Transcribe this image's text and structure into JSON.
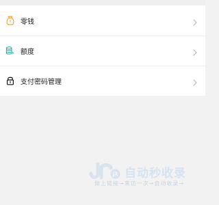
{
  "menu": {
    "items": [
      {
        "label": "零钱",
        "icon": "money-bag-icon"
      },
      {
        "label": "额度",
        "icon": "coin-stack-icon"
      },
      {
        "label": "支付密码管理",
        "icon": "lock-icon"
      }
    ]
  },
  "watermark": {
    "brand": "JR",
    "title": "自动秒收录",
    "subtitle": "做上链接→来访一次→自动收录→"
  },
  "colors": {
    "accent": "#f1a72b",
    "teal": "#2bb5a6",
    "icon_dark": "#111111",
    "chevron": "#b7b7b7",
    "watermark": "#d7e3ef"
  }
}
